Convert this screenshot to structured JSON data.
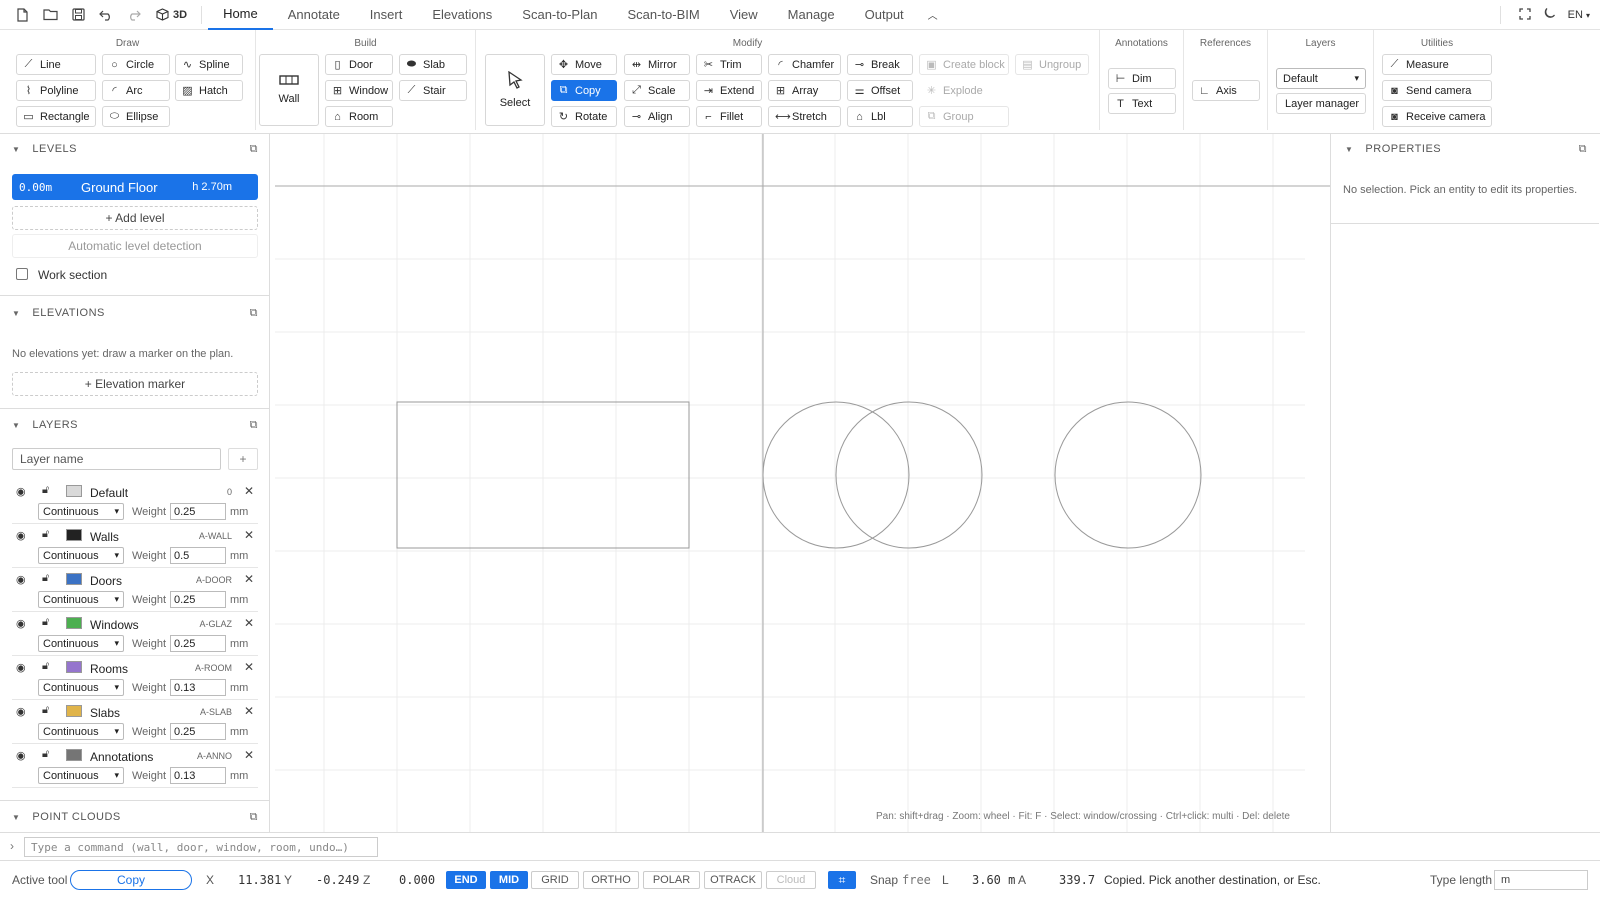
{
  "topbar": {
    "three_d_label": "3D",
    "tabs": [
      "Home",
      "Annotate",
      "Insert",
      "Elevations",
      "Scan-to-Plan",
      "Scan-to-BIM",
      "View",
      "Manage",
      "Output"
    ],
    "active_tab": "Home",
    "lang": "EN"
  },
  "ribbon": {
    "groups": {
      "draw": "Draw",
      "build": "Build",
      "modify": "Modify",
      "annotations": "Annotations",
      "references": "References",
      "layers": "Layers",
      "utilities": "Utilities"
    },
    "draw": {
      "line": "Line",
      "circle": "Circle",
      "spline": "Spline",
      "polyline": "Polyline",
      "arc": "Arc",
      "hatch": "Hatch",
      "rectangle": "Rectangle",
      "ellipse": "Ellipse"
    },
    "build": {
      "wall": "Wall",
      "door": "Door",
      "slab": "Slab",
      "window": "Window",
      "stair": "Stair",
      "room": "Room"
    },
    "modify": {
      "select": "Select",
      "move": "Move",
      "mirror": "Mirror",
      "trim": "Trim",
      "chamfer": "Chamfer",
      "break": "Break",
      "create_block": "Create block",
      "ungroup": "Ungroup",
      "copy": "Copy",
      "scale": "Scale",
      "extend": "Extend",
      "array": "Array",
      "offset": "Offset",
      "explode": "Explode",
      "rotate": "Rotate",
      "align": "Align",
      "fillet": "Fillet",
      "stretch": "Stretch",
      "lbl": "Lbl",
      "group": "Group"
    },
    "annotations": {
      "dim": "Dim",
      "text": "Text"
    },
    "references": {
      "axis": "Axis"
    },
    "layers": {
      "current": "Default",
      "manager": "Layer manager"
    },
    "utilities": {
      "measure": "Measure",
      "send_camera": "Send camera",
      "receive_camera": "Receive camera"
    }
  },
  "left": {
    "levels_title": "LEVELS",
    "level": {
      "elev": "0.00m",
      "name": "Ground Floor",
      "height": "h 2.70m"
    },
    "add_level": "+ Add level",
    "auto_detect": "Automatic level detection",
    "work_section": "Work section",
    "elevations_title": "ELEVATIONS",
    "elevations_empty": "No elevations yet: draw a marker on the plan.",
    "elevation_marker": "+ Elevation marker",
    "layers_title": "LAYERS",
    "layer_name_placeholder": "Layer name",
    "add_symbol": "+",
    "weight_label": "Weight",
    "mm_label": "mm",
    "layers": [
      {
        "name": "Default",
        "code": "0",
        "color": "#d9d9d9",
        "linetype": "Continuous",
        "weight": "0.25"
      },
      {
        "name": "Walls",
        "code": "A-WALL",
        "color": "#222222",
        "linetype": "Continuous",
        "weight": "0.5"
      },
      {
        "name": "Doors",
        "code": "A-DOOR",
        "color": "#3b72c4",
        "linetype": "Continuous",
        "weight": "0.25"
      },
      {
        "name": "Windows",
        "code": "A-GLAZ",
        "color": "#4caf50",
        "linetype": "Continuous",
        "weight": "0.25"
      },
      {
        "name": "Rooms",
        "code": "A-ROOM",
        "color": "#9575cd",
        "linetype": "Continuous",
        "weight": "0.13"
      },
      {
        "name": "Slabs",
        "code": "A-SLAB",
        "color": "#e0b44a",
        "linetype": "Continuous",
        "weight": "0.25"
      },
      {
        "name": "Annotations",
        "code": "A-ANNO",
        "color": "#757575",
        "linetype": "Continuous",
        "weight": "0.13"
      }
    ],
    "point_clouds_title": "POINT CLOUDS"
  },
  "canvas": {
    "hint": "Pan: shift+drag · Zoom: wheel · Fit: F · Select: window/crossing · Ctrl+click: multi · Del: delete"
  },
  "right": {
    "properties_title": "PROPERTIES",
    "empty": "No selection. Pick an entity to edit its properties."
  },
  "cmd": {
    "prompt": "›",
    "placeholder": "Type a command (wall, door, window, room, undo…)"
  },
  "status": {
    "active_tool_label": "Active tool",
    "active_tool": "Copy",
    "x_label": "X",
    "x": "11.381",
    "y_label": "Y",
    "y": "-0.249",
    "z_label": "Z",
    "z": "0.000",
    "toggles": [
      "END",
      "MID",
      "GRID",
      "ORTHO",
      "POLAR",
      "OTRACK",
      "Cloud"
    ],
    "toggles_on": [
      "END",
      "MID"
    ],
    "snap_label": "Snap",
    "snap": "free",
    "l_label": "L",
    "l": "3.60 m",
    "a_label": "A",
    "a": "339.7",
    "message": "Copied. Pick another destination, or Esc.",
    "type_length_label": "Type length",
    "type_length_value": "m"
  }
}
